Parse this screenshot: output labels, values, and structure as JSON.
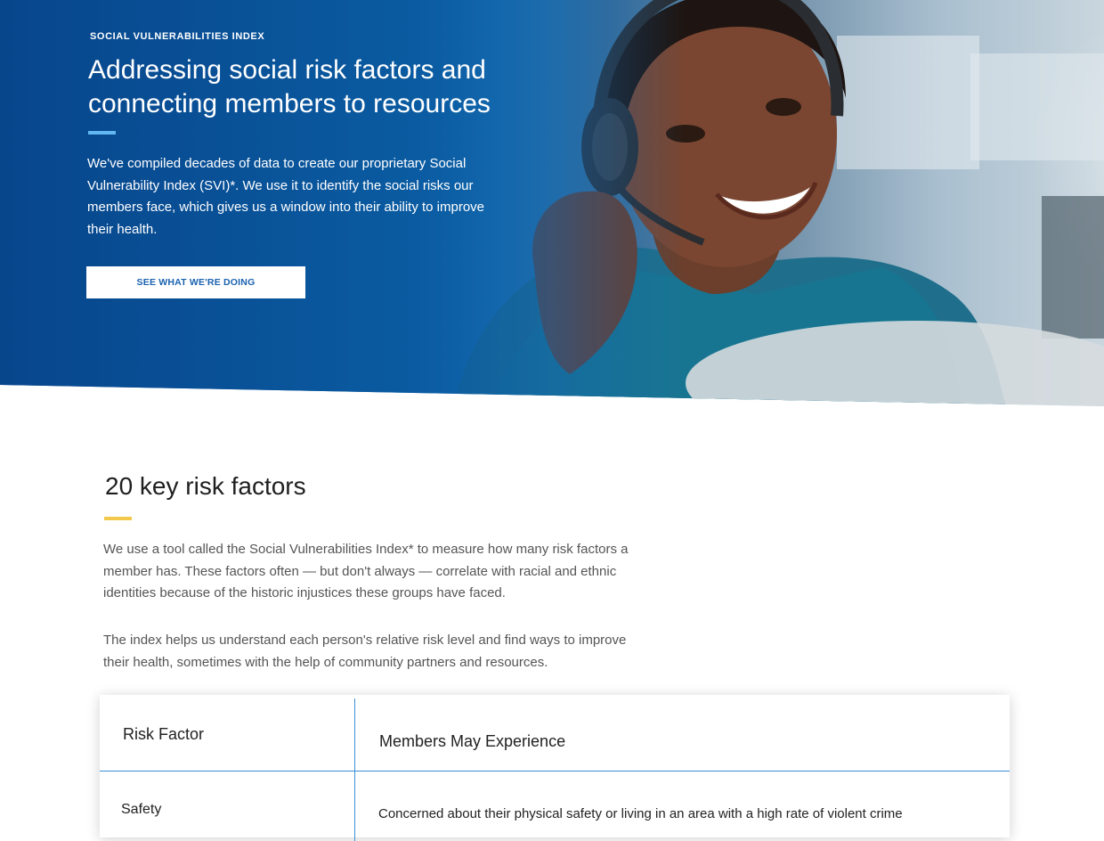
{
  "hero": {
    "eyebrow": "SOCIAL VULNERABILITIES INDEX",
    "title": "Addressing social risk factors and connecting members to resources",
    "body": "We've compiled decades of data to create our proprietary Social Vulnerability Index (SVI)*. We use it to identify the social risks our members face, which gives us a window into their ability to improve their health.",
    "cta_label": "SEE WHAT WE'RE DOING"
  },
  "section": {
    "title": "20 key risk factors",
    "paragraph1": "We use a tool called the Social Vulnerabilities Index* to measure how many risk factors a member has. These factors often — but don't always — correlate with racial and ethnic identities because of the historic injustices these groups have faced.",
    "paragraph2": "The index helps us understand each person's relative risk level and find ways to improve their health, sometimes with the help of community partners and resources."
  },
  "table": {
    "headers": [
      "Risk Factor",
      "Members May Experience"
    ],
    "rows": [
      {
        "factor": "Safety",
        "experience": "Concerned about their physical safety or living in an area with a high rate of violent crime"
      }
    ]
  },
  "colors": {
    "hero_blue": "#0a4f96",
    "hero_accent_rule": "#63b7f0",
    "section_accent_rule": "#f2c94c",
    "table_line": "#3b8fd6",
    "cta_text": "#1a62b0"
  },
  "icons": {
    "hero_image": "woman-with-headset-photo"
  }
}
